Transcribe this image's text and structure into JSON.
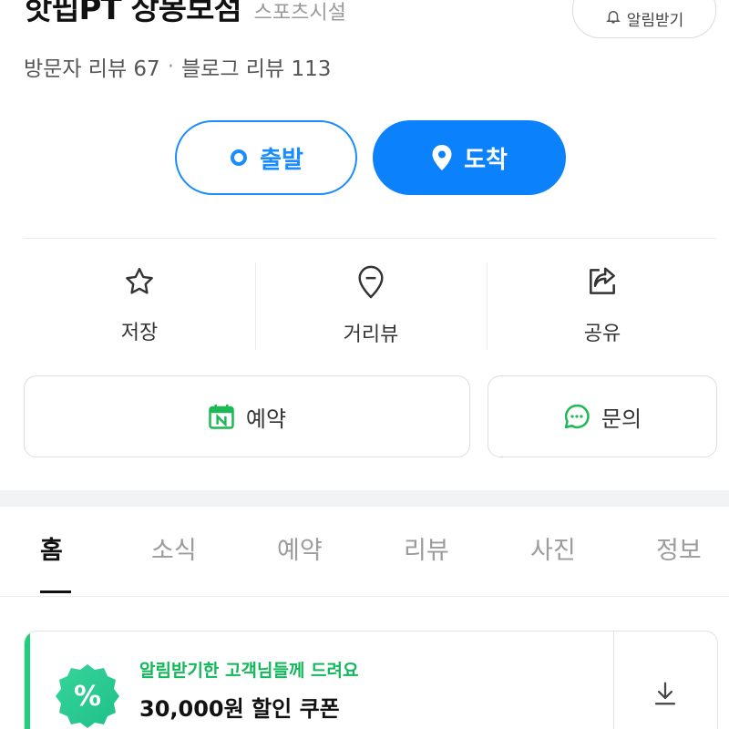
{
  "place": {
    "title": "핫핍PT 상봉보점",
    "category": "스포츠시설",
    "alarm_label": "알림받기"
  },
  "reviews": {
    "visitor": "방문자 리뷰 67",
    "separator": "·",
    "blog": "블로그 리뷰 113"
  },
  "route": {
    "start_label": "출발",
    "arrive_label": "도착",
    "accent_color": "#0b82fb"
  },
  "actions": {
    "save_label": "저장",
    "streetview_label": "거리뷰",
    "share_label": "공유"
  },
  "buttons": {
    "reserve_label": "예약",
    "inquiry_label": "문의"
  },
  "tabs": [
    {
      "label": "홈",
      "active": true
    },
    {
      "label": "소식"
    },
    {
      "label": "예약"
    },
    {
      "label": "리뷰"
    },
    {
      "label": "사진"
    },
    {
      "label": "정보"
    }
  ],
  "coupon": {
    "subtitle": "알림받기한 고객님들께 드려요",
    "title": "30,000원 할인 쿠폰",
    "badge_symbol": "%",
    "accent_color": "#1fcf7a"
  },
  "icons": {
    "alarm": "bell-icon",
    "start": "origin-dot-icon",
    "arrive": "location-pin-icon",
    "save": "star-icon",
    "streetview": "streetview-pin-icon",
    "share": "share-icon",
    "reserve": "naver-calendar-icon",
    "inquiry": "chat-bubble-icon",
    "download": "download-icon"
  }
}
